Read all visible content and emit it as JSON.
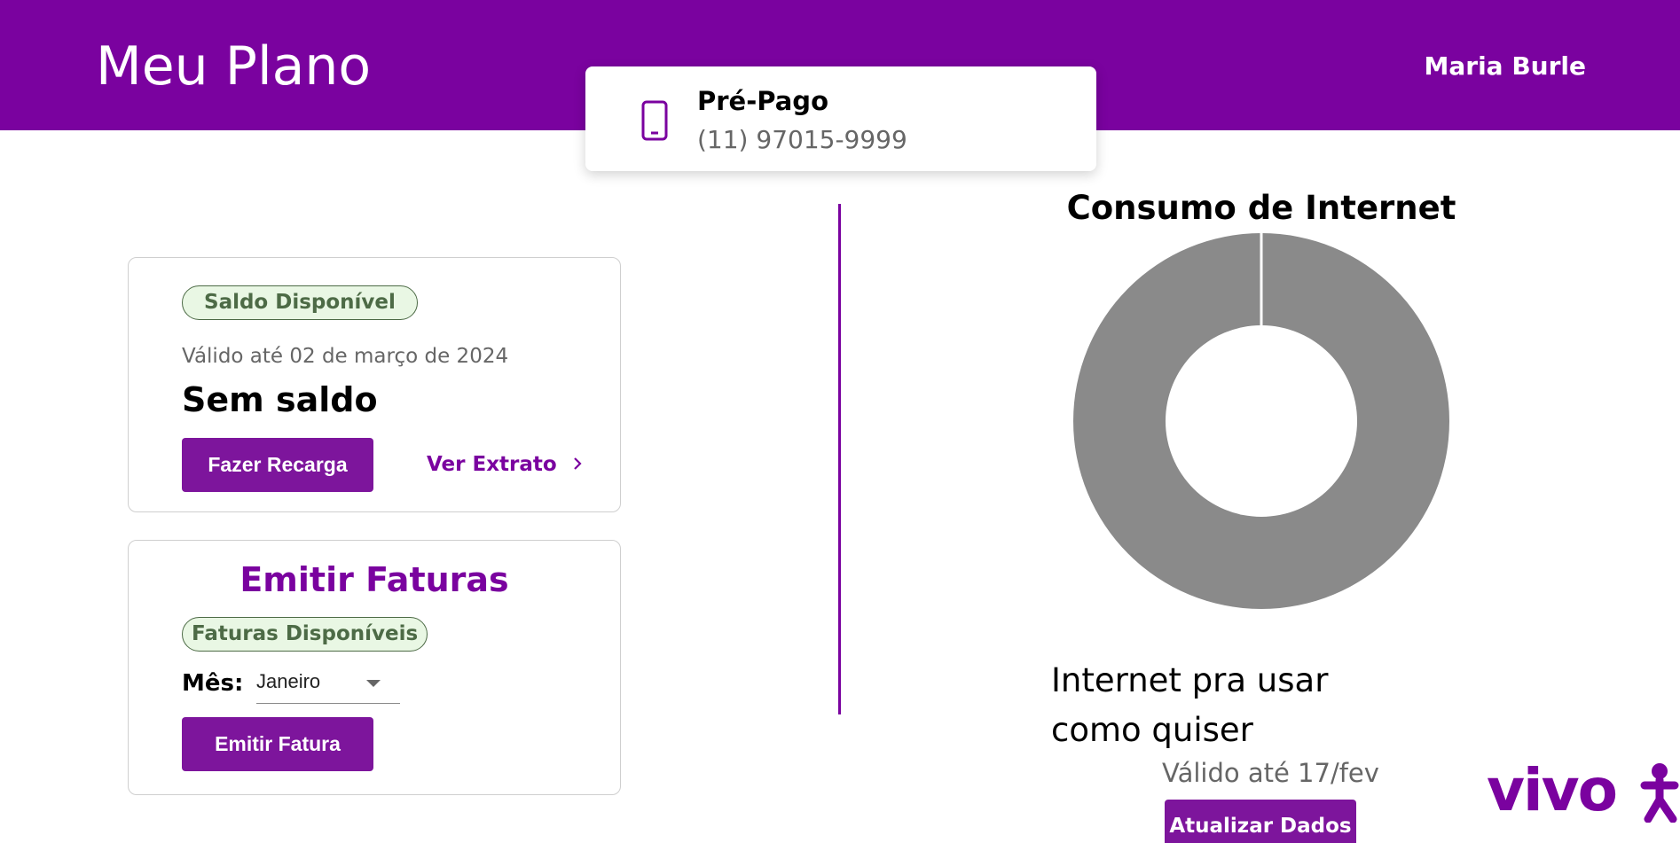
{
  "header": {
    "title": "Meu Plano",
    "user_name": "Maria Burle"
  },
  "plan": {
    "type": "Pré-Pago",
    "number": "(11) 97015-9999",
    "icon": "smartphone-icon"
  },
  "saldo_card": {
    "badge": "Saldo Disponível",
    "valid_until": "Válido até 02 de março de 2024",
    "value": "Sem saldo",
    "recharge_button": "Fazer Recarga",
    "extract_link": "Ver Extrato",
    "extract_icon": "chevron-right-icon"
  },
  "faturas_card": {
    "title": "Emitir Faturas",
    "badge": "Faturas Disponíveis",
    "month_label": "Mês:",
    "month_selected": "Janeiro",
    "emit_button": "Emitir Fatura"
  },
  "internet": {
    "chart_title": "Consumo de Internet",
    "description": "Internet pra usar como quiser",
    "valid_until": "Válido até 17/fev",
    "update_button": "Atualizar Dados"
  },
  "colors": {
    "brand_purple": "#7a029f",
    "button_purple": "#7d159c",
    "donut_gray": "#8a8a8a",
    "badge_green_bg": "#e9f7e4",
    "badge_green_text": "#4d6b46"
  },
  "logo": {
    "text": "vivo"
  },
  "chart_data": {
    "type": "pie",
    "title": "Consumo de Internet",
    "values": [
      100
    ],
    "colors": [
      "#8a8a8a"
    ]
  }
}
